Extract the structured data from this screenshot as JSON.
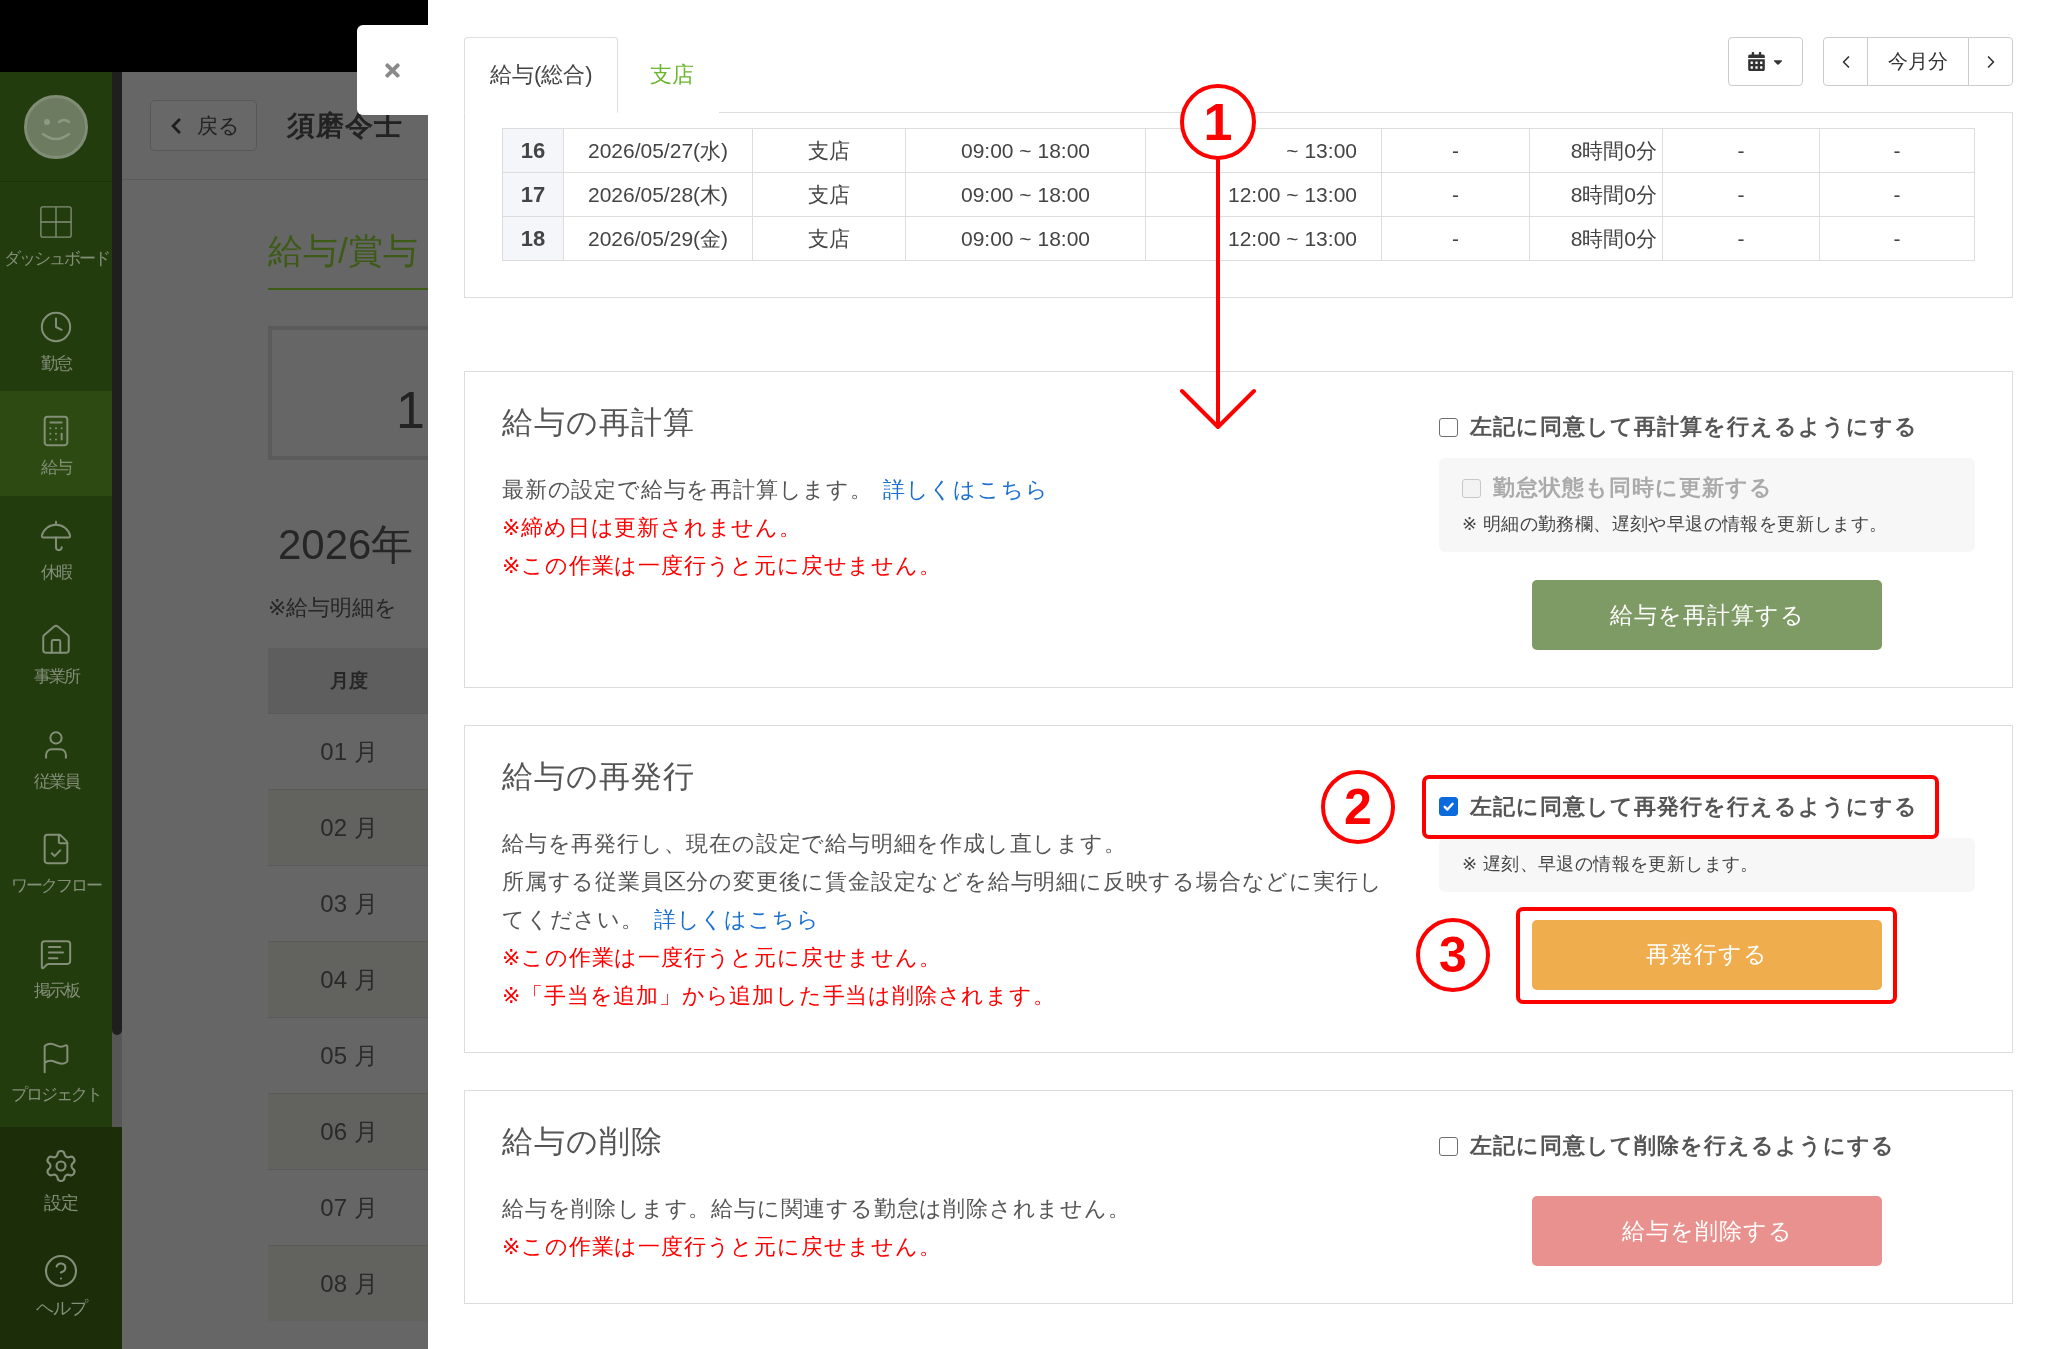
{
  "background_page": {
    "sidebar": {
      "items": [
        {
          "label": "ダッシュボード",
          "selected": false
        },
        {
          "label": "勤怠",
          "selected": false
        },
        {
          "label": "給与",
          "selected": true
        },
        {
          "label": "休暇",
          "selected": false
        },
        {
          "label": "事業所",
          "selected": false
        },
        {
          "label": "従業員",
          "selected": false
        },
        {
          "label": "ワークフロー",
          "selected": false
        },
        {
          "label": "掲示板",
          "selected": false
        },
        {
          "label": "プロジェクト",
          "selected": false
        }
      ],
      "footer_items": [
        {
          "label": "設定"
        },
        {
          "label": "ヘルプ"
        }
      ]
    },
    "header": {
      "back_button": "戻る",
      "employee_name": "須磨令士"
    },
    "content": {
      "title": "給与/賞与",
      "summary_value": "1",
      "year_heading": "2026年",
      "note": "※給与明細を",
      "month_table": {
        "header": "月度",
        "rows": [
          "01 月",
          "02 月",
          "03 月",
          "04 月",
          "05 月",
          "06 月",
          "07 月",
          "08 月"
        ]
      }
    }
  },
  "modal": {
    "tabs": [
      {
        "label": "給与(総合)",
        "selected": true
      },
      {
        "label": "支店",
        "selected": false
      }
    ],
    "period_button": "今月分",
    "scroll_callout": "1",
    "attendance_table": {
      "rows": [
        [
          "16",
          "2026/05/27(水)",
          "支店",
          "09:00 ~ 18:00",
          "~ 13:00",
          "-",
          "8時間0分",
          "-",
          "-"
        ],
        [
          "17",
          "2026/05/28(木)",
          "支店",
          "09:00 ~ 18:00",
          "12:00 ~ 13:00",
          "-",
          "8時間0分",
          "-",
          "-"
        ],
        [
          "18",
          "2026/05/29(金)",
          "支店",
          "09:00 ~ 18:00",
          "12:00 ~ 13:00",
          "-",
          "8時間0分",
          "-",
          "-"
        ]
      ]
    },
    "sections": [
      {
        "title": "給与の再計算",
        "paragraphs": [
          "最新の設定で給与を再計算します。"
        ],
        "link": "詳しくはこちら",
        "warnings": [
          "※締め日は更新されません。",
          "※この作業は一度行うと元に戻せません。"
        ],
        "consent": {
          "label": "左記に同意して再計算を行えるようにする",
          "checked": false
        },
        "options": {
          "checkbox": {
            "label": "勤怠状態も同時に更新する",
            "checked": false,
            "disabled": true
          },
          "note": "※ 明細の勤務欄、遅刻や早退の情報を更新します。"
        },
        "button": {
          "label": "給与を再計算する",
          "kind": "primary",
          "disabled": true
        }
      },
      {
        "title": "給与の再発行",
        "paragraphs": [
          "給与を再発行し、現在の設定で給与明細を作成し直します。",
          "所属する従業員区分の変更後に賃金設定などを給与明細に反映する場合などに実行してください。"
        ],
        "link": "詳しくはこちら",
        "warnings": [
          "※この作業は一度行うと元に戻せません。",
          "※「手当を追加」から追加した手当は削除されます。"
        ],
        "consent": {
          "label": "左記に同意して再発行を行えるようにする",
          "checked": true,
          "callout": "2"
        },
        "options": {
          "note": "※ 遅刻、早退の情報を更新します。"
        },
        "button": {
          "label": "再発行する",
          "kind": "warning",
          "disabled": false,
          "callout": "3"
        }
      },
      {
        "title": "給与の削除",
        "paragraphs": [
          "給与を削除します。給与に関連する勤怠は削除されません。"
        ],
        "warnings": [
          "※この作業は一度行うと元に戻せません。"
        ],
        "consent": {
          "label": "左記に同意して削除を行えるようにする",
          "checked": false
        },
        "button": {
          "label": "給与を削除する",
          "kind": "danger",
          "disabled": true
        }
      }
    ]
  }
}
